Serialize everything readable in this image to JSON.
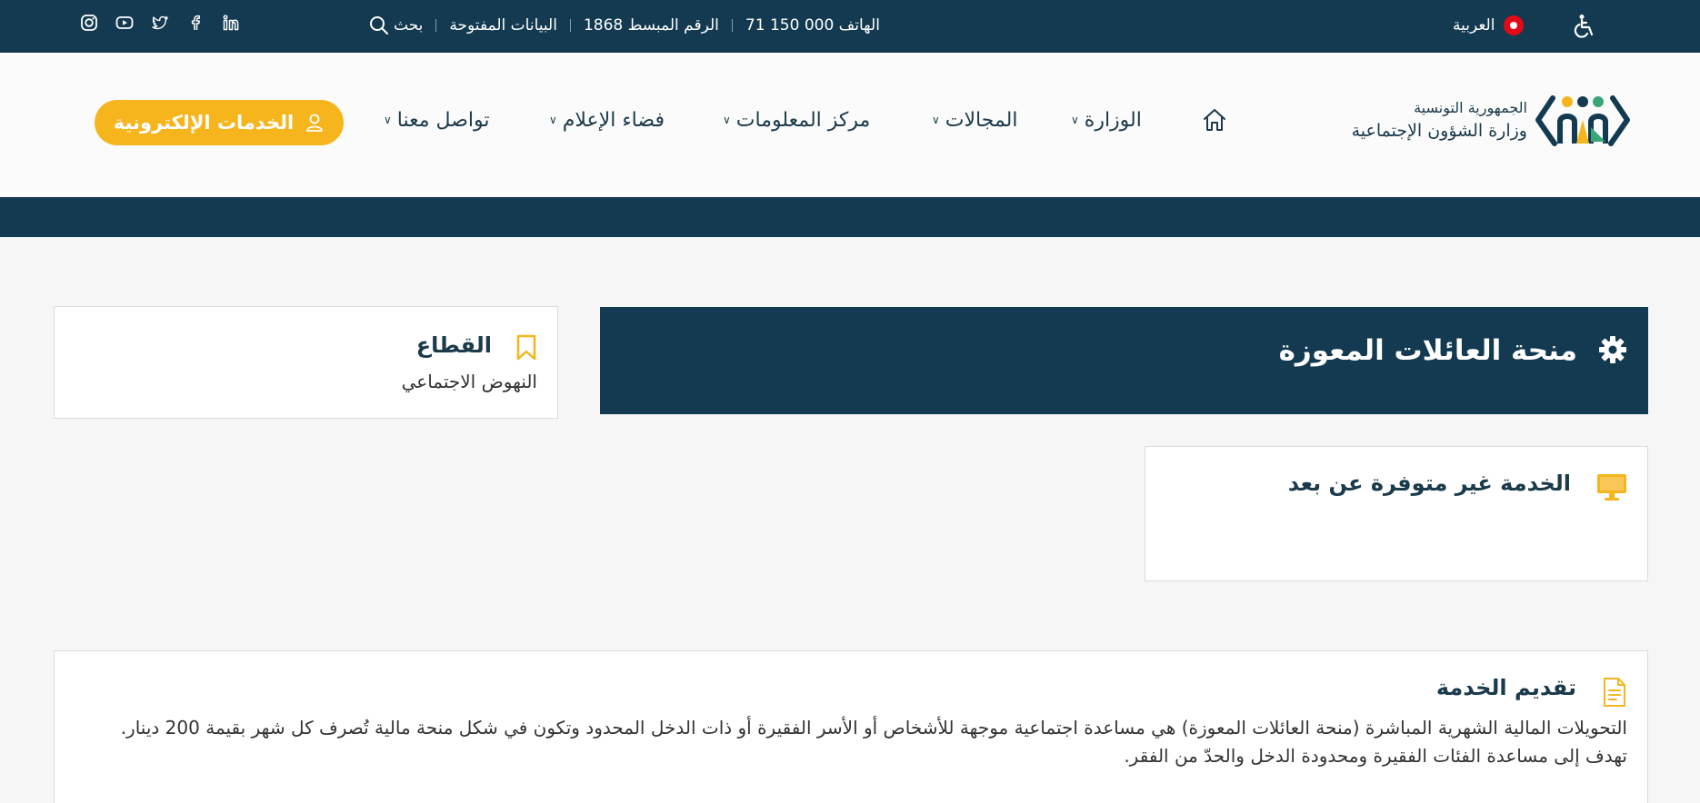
{
  "topbar": {
    "social": [
      "instagram-icon",
      "youtube-icon",
      "twitter-icon",
      "facebook-icon",
      "linkedin-icon"
    ],
    "search_label": "بحث",
    "open_data": "البيانات المفتوحة",
    "green_number": "الرقم المبسط 1868",
    "phone": "الهاتف 000 150 71",
    "language": "العربية"
  },
  "brand": {
    "line1": "الجمهورية التونسية",
    "line2": "وزارة الشؤون الإجتماعية"
  },
  "nav": {
    "ministry": "الوزارة",
    "domains": "المجالات",
    "info_center": "مركز المعلومات",
    "media": "فضاء الإعلام",
    "contact": "تواصل معنا",
    "eservices": "الخدمات الإلكترونية"
  },
  "page": {
    "title": "منحة العائلات المعوزة",
    "sector_label": "القطاع",
    "sector_value": "النهوض الاجتماعي",
    "availability": "الخدمة غير متوفرة عن بعد",
    "presentation_title": "تقديم الخدمة",
    "presentation_p1": "التحويلات المالية الشهرية المباشرة (منحة العائلات المعوزة) هي مساعدة اجتماعية موجهة للأشخاص أو الأسر الفقيرة أو ذات الدخل المحدود وتكون في شكل منحة مالية تُصرف كل شهر بقيمة 200 دينار.",
    "presentation_p2": "تهدف إلى مساعدة الفئات الفقيرة ومحدودة الدخل والحدّ من الفقر."
  },
  "colors": {
    "navy": "#133a51",
    "accent": "#f6b51d",
    "text": "#1b3a4b"
  }
}
